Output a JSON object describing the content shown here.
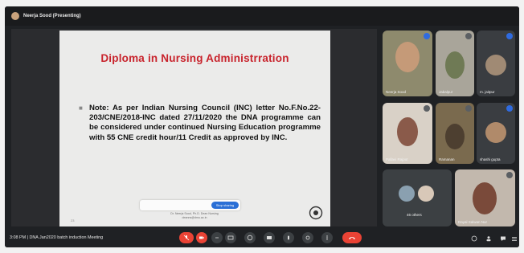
{
  "topbar": {
    "presenter_label": "Neerja Sood (Presenting)"
  },
  "slide": {
    "title": "Diploma in Nursing Administrration",
    "note": "Note: As per Indian Nursing Council (INC) letter No.F.No.22-203/CNE/2018-INC dated 27/11/2020 the DNA programme can be considered under continued Nursing Education programme with 55 CNE credit hour/11 Credit as approved by INC.",
    "toolbar_button": "Stop sharing",
    "footer_line1": "Dr. Neerja Sood, Ph.D. Dean Nursing",
    "footer_line2": "deanns@dmu.ac.in",
    "page_number": "23"
  },
  "participants": [
    {
      "name": "Neerja Sood",
      "color": "#2f6be0"
    },
    {
      "name": "Jabalpur"
    },
    {
      "name": "m. jaitpur"
    },
    {
      "name": "Pallavi Rajput"
    },
    {
      "name": "Ramanan"
    },
    {
      "name": "shashi gupta"
    },
    {
      "name": "46 others"
    },
    {
      "name": "Dayal Salwan Nur"
    }
  ],
  "bottombar": {
    "meeting_info": "3:08 PM  |  DNA Jan2020 batch induction Meeting"
  },
  "colors": {
    "leave": "#ea4335",
    "mic_off": "#ea4335",
    "slide_title": "#c8232c"
  }
}
